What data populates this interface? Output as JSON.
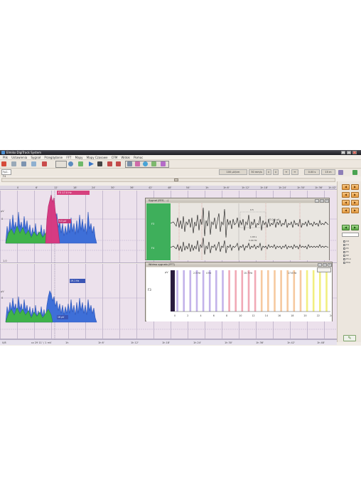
{
  "app": {
    "title": "Elmiko DigiTrack System"
  },
  "menu": [
    "Plik",
    "Ustawienia",
    "Sygnał",
    "Przeglądanie",
    "FFT",
    "Mapy",
    "Mapy Czasowe",
    "CFM",
    "Widok",
    "Pomoc"
  ],
  "montage": {
    "value": "Fp2-F4"
  },
  "controls": {
    "gain": "100 µV/cm",
    "speed": "30 mm/s",
    "offset": "0.00 s",
    "span": "15 m"
  },
  "ruler": {
    "ticks": [
      "0",
      "6'",
      "12'",
      "18'",
      "24'",
      "30'",
      "36'",
      "42'",
      "48'",
      "54'",
      "1h",
      "1h 6'",
      "1h 12'",
      "1h 18'",
      "1h 24'",
      "1h 30'",
      "1h 36'",
      "1h 42'",
      "1h 48'"
    ]
  },
  "trend_top": {
    "y_unit": "µV",
    "y_tick": "0",
    "flag_label": "F3 17.0 Hz",
    "marker_label": "9.5 µV",
    "scale_label": "1.0",
    "ticks": [
      "0",
      "6'",
      "12'",
      "18'",
      "24'",
      "30'",
      "36'",
      "42'",
      "48'",
      "54'"
    ]
  },
  "trend_bottom": {
    "y_unit": "µV",
    "y_tick": "0",
    "marker_label_1": "19.1 Hz",
    "marker_label_2": "16 µV",
    "scale_label": "0.5",
    "footer_left": "0/8",
    "footer_time": "cz 29 11' / 1 mV",
    "footer_ticks": [
      "1h",
      "1h 6'",
      "1h 12'",
      "1h 18'",
      "1h 24'",
      "1h 30'",
      "1h 36'",
      "1h 42'",
      "1h 48'"
    ]
  },
  "signal_window": {
    "title": "Sygnał (EEG, ...)",
    "channels": [
      "F3",
      "F4"
    ],
    "annotation_1": "F3 2.5 µV",
    "annotation_2": "1.00 s",
    "annotation_3": "0.00 Hz",
    "annotation_4": "0.5"
  },
  "fft_window": {
    "title": "Widmo sygnału (FFT)",
    "y_unit": "µV",
    "channel": "F3",
    "band_labels": [
      "2.5 Hz",
      "4 Hz",
      "10.7 Hz",
      "17.6 Hz"
    ],
    "x_ticks": [
      "0",
      "2",
      "4",
      "6",
      "8",
      "10",
      "12",
      "14",
      "16",
      "18",
      "20",
      "22",
      "24"
    ]
  },
  "sidebar": {
    "checkboxes": [
      "O2",
      "O1",
      "P4",
      "P3",
      "PZ",
      "P3-A",
      "EKG"
    ]
  },
  "colors": {
    "accent": "#3eaf5b",
    "band_purple": "#b8a6e6",
    "band_red": "#ef9aa9",
    "band_orange": "#f4c08e",
    "band_yellow": "#f0ec6a"
  }
}
